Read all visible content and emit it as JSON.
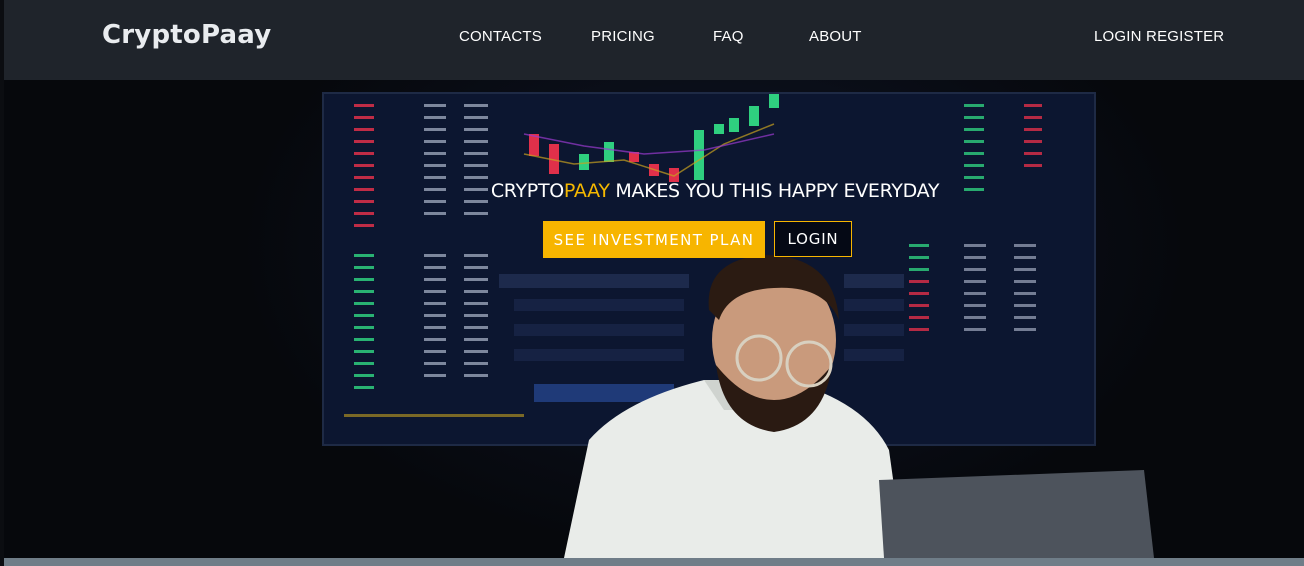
{
  "brand": {
    "name": "CryptoPaay"
  },
  "nav": {
    "contacts": "CONTACTS",
    "pricing": "PRICING",
    "faq": "FAQ",
    "about": "ABOUT",
    "auth": "LOGIN REGISTER"
  },
  "hero": {
    "headline_prefix": "CRYPTO",
    "headline_accent": "PAAY",
    "headline_suffix": " MAKES YOU THIS HAPPY EVERYDAY",
    "primary_button": "SEE INVESTMENT PLAN",
    "secondary_button": "LOGIN",
    "image_description_icon": "trader-at-laptop-photo"
  },
  "colors": {
    "navbar_bg": "#1f242b",
    "accent": "#f7b500",
    "hero_bg": "#06080c",
    "bottom_strip": "#6f7d88"
  }
}
